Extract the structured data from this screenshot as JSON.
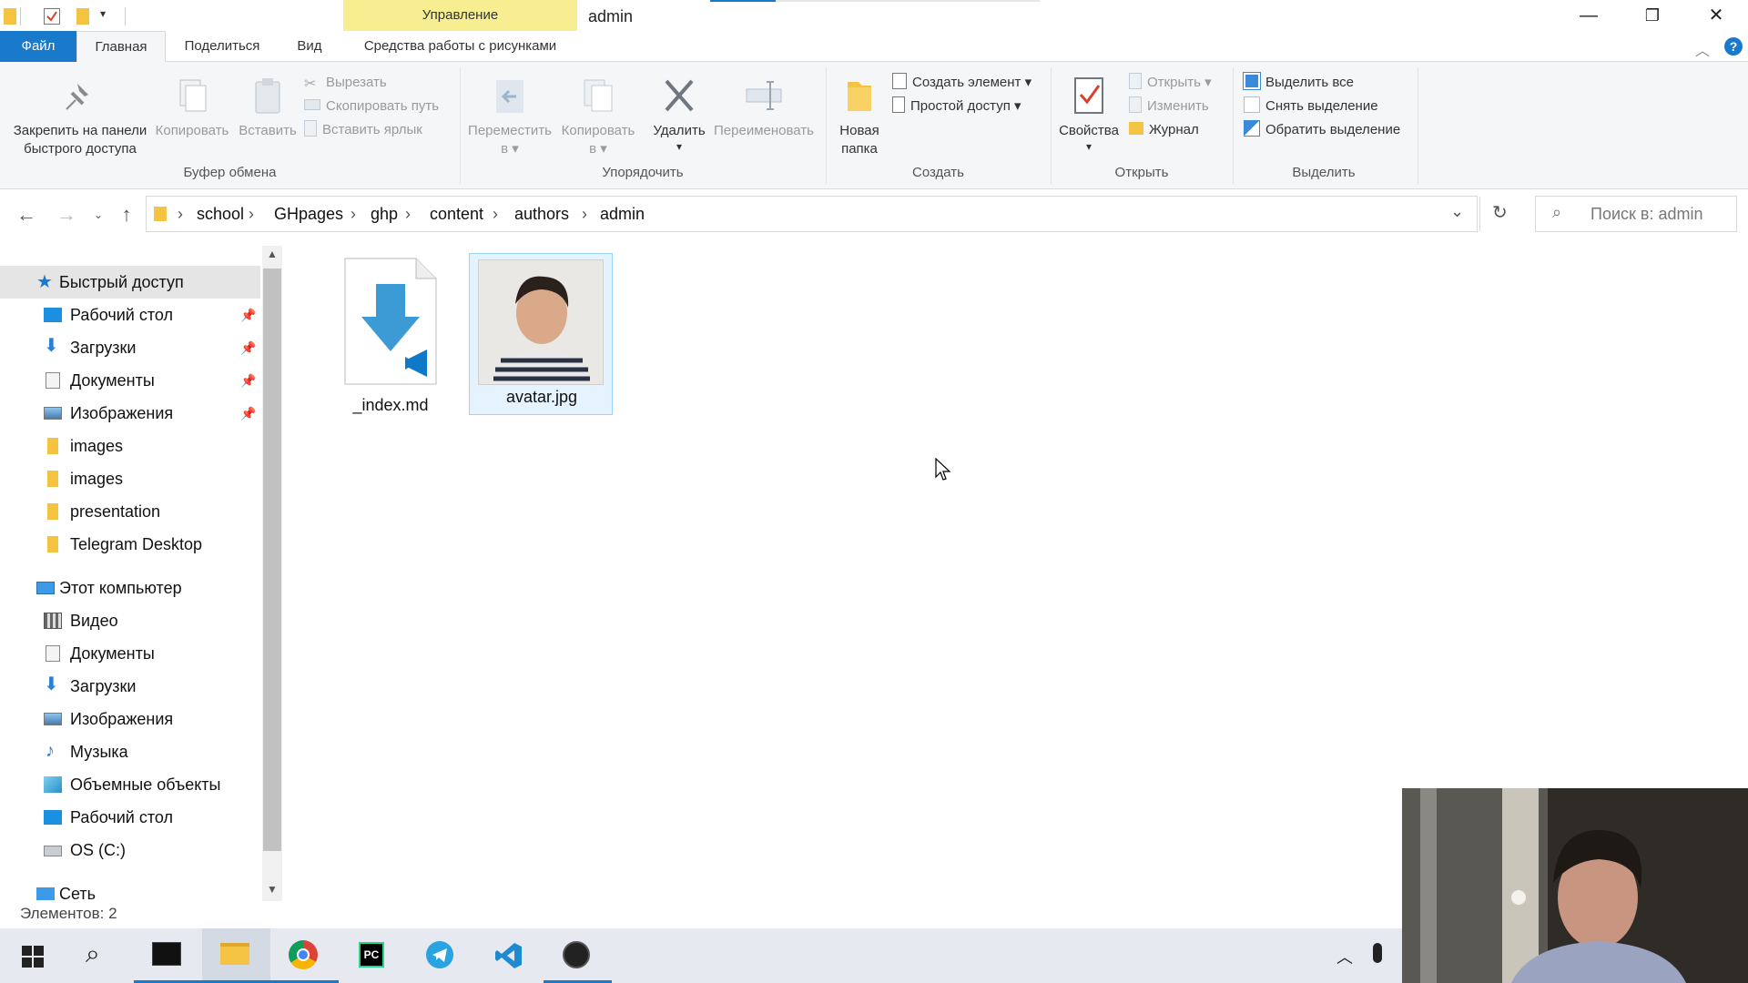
{
  "window": {
    "title": "admin",
    "context_tab": "Управление",
    "controls": {
      "minimize": "—",
      "restore": "❐",
      "close": "✕"
    }
  },
  "tabs": [
    {
      "label": "Файл"
    },
    {
      "label": "Главная"
    },
    {
      "label": "Поделиться"
    },
    {
      "label": "Вид"
    },
    {
      "label": "Средства работы с рисунками"
    }
  ],
  "ribbon": {
    "clipboard": {
      "label": "Буфер обмена",
      "pin_line1": "Закрепить на панели",
      "pin_line2": "быстрого доступа",
      "copy": "Копировать",
      "paste": "Вставить",
      "cut": "Вырезать",
      "copy_path": "Скопировать путь",
      "paste_shortcut": "Вставить ярлык"
    },
    "organize": {
      "label": "Упорядочить",
      "move_line1": "Переместить",
      "move_line2": "в ▾",
      "copy_line1": "Копировать",
      "copy_line2": "в ▾",
      "delete": "Удалить",
      "delete_arrow": "▾",
      "rename": "Переименовать"
    },
    "new": {
      "label": "Создать",
      "new_folder_line1": "Новая",
      "new_folder_line2": "папка",
      "new_item": "Создать элемент ▾",
      "easy_access": "Простой доступ ▾"
    },
    "open": {
      "label": "Открыть",
      "properties": "Свойства",
      "properties_arrow": "▾",
      "open": "Открыть ▾",
      "edit": "Изменить",
      "history": "Журнал"
    },
    "select": {
      "label": "Выделить",
      "select_all": "Выделить все",
      "select_none": "Снять выделение",
      "invert": "Обратить выделение"
    }
  },
  "address": {
    "crumbs": [
      "school",
      "GHpages",
      "ghp",
      "content",
      "authors",
      "admin"
    ],
    "separator": "›",
    "search_placeholder": "Поиск в: admin"
  },
  "sidebar": {
    "quick_access": "Быстрый доступ",
    "quick_items": [
      {
        "label": "Рабочий стол",
        "pinned": true
      },
      {
        "label": "Загрузки",
        "pinned": true
      },
      {
        "label": "Документы",
        "pinned": true
      },
      {
        "label": "Изображения",
        "pinned": true
      },
      {
        "label": "images"
      },
      {
        "label": "images"
      },
      {
        "label": "presentation"
      },
      {
        "label": "Telegram Desktop"
      }
    ],
    "this_pc": "Этот компьютер",
    "pc_items": [
      {
        "label": "Видео"
      },
      {
        "label": "Документы"
      },
      {
        "label": "Загрузки"
      },
      {
        "label": "Изображения"
      },
      {
        "label": "Музыка"
      },
      {
        "label": "Объемные объекты"
      },
      {
        "label": "Рабочий стол"
      },
      {
        "label": "OS (C:)"
      }
    ],
    "network": "Сеть"
  },
  "files": [
    {
      "name": "_index.md",
      "icon": "vscode-markdown-file-icon"
    },
    {
      "name": "avatar.jpg",
      "icon": "photo-thumbnail",
      "selected": true
    }
  ],
  "status": {
    "items_count": "Элементов: 2"
  },
  "colors": {
    "accent": "#1979ca",
    "context_tab": "#f6ee91",
    "folder": "#f5c342"
  }
}
